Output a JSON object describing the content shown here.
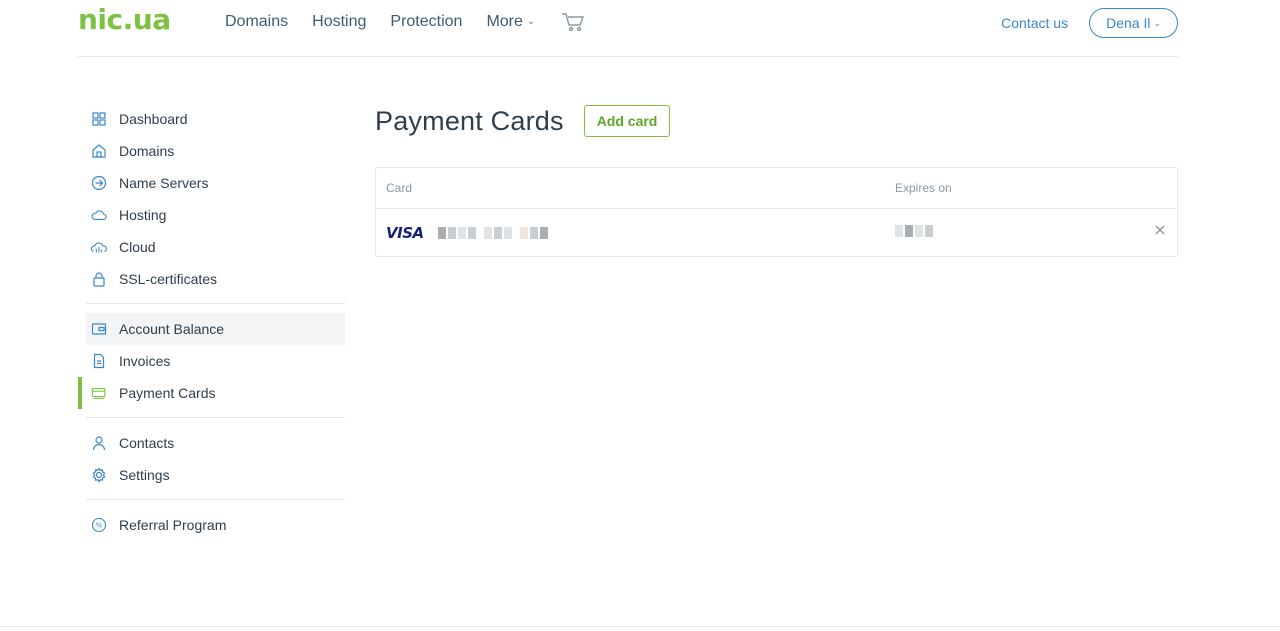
{
  "brand": {
    "logo": "nic.ua",
    "accent": "#7cc142",
    "link": "#3a87c9"
  },
  "nav": {
    "items": [
      "Domains",
      "Hosting",
      "Protection",
      "More"
    ],
    "cart_icon": "cart-icon"
  },
  "header": {
    "contact": "Contact us",
    "user": "Dena Il"
  },
  "sidebar": {
    "groups": [
      [
        {
          "label": "Dashboard",
          "icon": "dashboard-grid-icon"
        },
        {
          "label": "Domains",
          "icon": "domains-house-icon"
        },
        {
          "label": "Name Servers",
          "icon": "arrow-circle-icon"
        },
        {
          "label": "Hosting",
          "icon": "cloud-icon"
        },
        {
          "label": "Cloud",
          "icon": "cloud-servers-icon"
        },
        {
          "label": "SSL-certificates",
          "icon": "lock-icon"
        }
      ],
      [
        {
          "label": "Account Balance",
          "icon": "wallet-icon"
        },
        {
          "label": "Invoices",
          "icon": "document-icon"
        },
        {
          "label": "Payment Cards",
          "icon": "card-icon"
        }
      ],
      [
        {
          "label": "Contacts",
          "icon": "person-icon"
        },
        {
          "label": "Settings",
          "icon": "gear-icon"
        }
      ],
      [
        {
          "label": "Referral Program",
          "icon": "percent-icon"
        }
      ]
    ],
    "active": "Payment Cards",
    "hovered": "Account Balance"
  },
  "main": {
    "title": "Payment Cards",
    "add_button": "Add card",
    "table": {
      "headers": [
        "Card",
        "Expires on"
      ],
      "rows": [
        {
          "brand": "VISA",
          "number_masked": true,
          "expires_masked": true
        }
      ]
    }
  }
}
